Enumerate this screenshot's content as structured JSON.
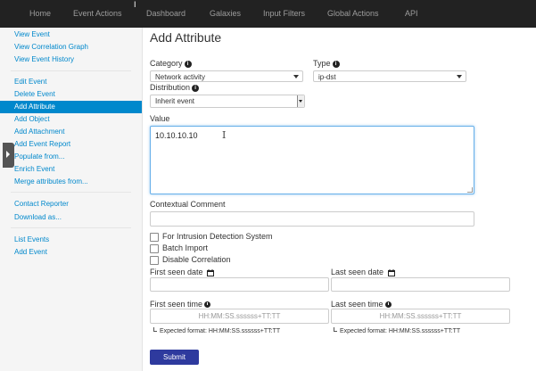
{
  "nav": {
    "items": [
      "Home",
      "Event Actions",
      "Dashboard",
      "Galaxies",
      "Input Filters",
      "Global Actions",
      "API"
    ]
  },
  "sidebar": {
    "items": [
      "View Event",
      "View Correlation Graph",
      "View Event History",
      "Edit Event",
      "Delete Event",
      "Add Attribute",
      "Add Object",
      "Add Attachment",
      "Add Event Report",
      "Populate from...",
      "Enrich Event",
      "Merge attributes from...",
      "Contact Reporter",
      "Download as...",
      "List Events",
      "Add Event"
    ],
    "active_item": "Add Attribute"
  },
  "form": {
    "title": "Add Attribute",
    "category_label": "Category",
    "category_value": "Network activity",
    "type_label": "Type",
    "type_value": "ip-dst",
    "distribution_label": "Distribution",
    "distribution_value": "Inherit event",
    "value_label": "Value",
    "value_text": "10.10.10.10",
    "comment_label": "Contextual Comment",
    "ids_label": "For Intrusion Detection System",
    "batch_label": "Batch Import",
    "disable_corr_label": "Disable Correlation",
    "first_seen_date_label": "First seen date",
    "last_seen_date_label": "Last seen date",
    "first_seen_time_label": "First seen time",
    "last_seen_time_label": "Last seen time",
    "time_placeholder": "HH:MM:SS.ssssss+TT:TT",
    "expected_format": "Expected format: HH:MM:SS.ssssss+TT:TT",
    "submit_label": "Submit"
  },
  "colors": {
    "link": "#0088cc",
    "navbar": "#222222",
    "submit": "#2e3a9e",
    "focus_border": "#66afe9"
  }
}
